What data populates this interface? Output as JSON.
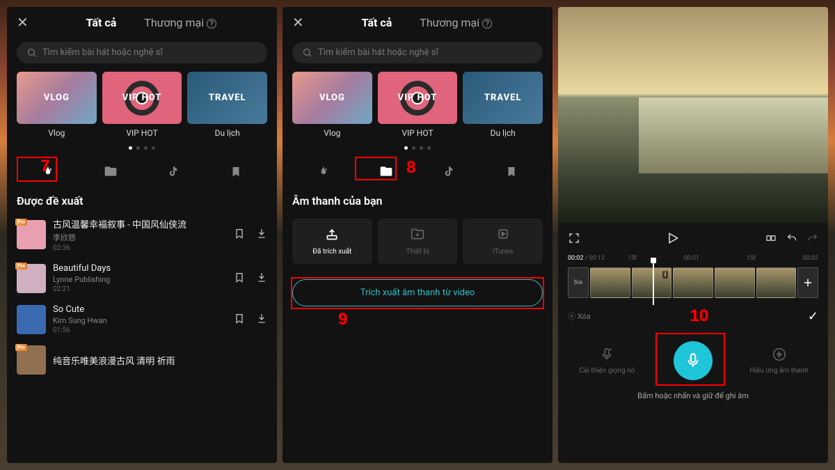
{
  "annotations": {
    "n7": "7",
    "n8": "8",
    "n9": "9",
    "n10": "10"
  },
  "header": {
    "tab_all": "Tất cả",
    "tab_commercial": "Thương mại"
  },
  "search": {
    "placeholder": "Tìm kiếm bài hát hoặc nghệ sĩ"
  },
  "categories": [
    {
      "img_text": "VLOG",
      "label": "Vlog"
    },
    {
      "img_text": "VIP HOT",
      "label": "VIP HOT"
    },
    {
      "img_text": "TRAVEL",
      "label": "Du lịch"
    }
  ],
  "panel1": {
    "section_title": "Được đề xuất",
    "songs": [
      {
        "title": "古风温馨幸福叙事 - 中国风仙侠流",
        "artist": "李欣慈",
        "dur": "02:36",
        "pro": true,
        "thumb": "#e8a0b0"
      },
      {
        "title": "Beautiful Days",
        "artist": "Lynne Publishing",
        "dur": "02:21",
        "pro": true,
        "thumb": "#d0b0c0"
      },
      {
        "title": "So Cute",
        "artist": "Kim Sung Hwan",
        "dur": "01:56",
        "pro": false,
        "thumb": "#3a6ab0"
      },
      {
        "title": "纯音乐唯美浪漫古风 清明 祈雨",
        "artist": "",
        "dur": "",
        "pro": true,
        "thumb": "#907050"
      }
    ]
  },
  "panel2": {
    "section_title": "Âm thanh của bạn",
    "tabs": [
      {
        "label": "Đã trích xuất",
        "active": true
      },
      {
        "label": "Thiết bị",
        "active": false
      },
      {
        "label": "iTunes",
        "active": false
      }
    ],
    "extract_label": "Trích xuất âm thanh từ video"
  },
  "panel3": {
    "time_current": "00:02",
    "time_total": "00:12",
    "ticks": [
      "15f",
      "00:01",
      "15f",
      "00:02"
    ],
    "cover_label": "bìa",
    "delete_label": "Xóa",
    "left_opt": "Cải thiện giọng nó",
    "right_opt": "Hiệu ứng âm thanh",
    "hint": "Bấm hoặc nhấn và giữ để ghi âm"
  }
}
